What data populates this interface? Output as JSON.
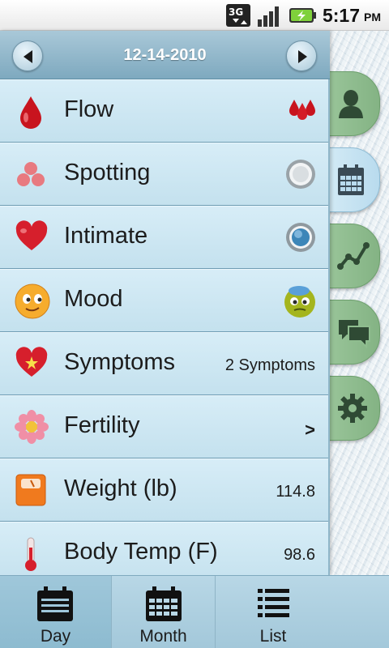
{
  "status_bar": {
    "time": "5:17",
    "ampm": "PM",
    "network_label": "3G"
  },
  "header": {
    "date": "12-14-2010"
  },
  "rows": [
    {
      "label": "Flow",
      "value": "",
      "icon": "blood-drop-icon",
      "right_icon": "heavy-flow-drops-icon"
    },
    {
      "label": "Spotting",
      "value": "",
      "icon": "spotting-dots-icon",
      "right_icon": "radio-off-icon"
    },
    {
      "label": "Intimate",
      "value": "",
      "icon": "heart-icon",
      "right_icon": "radio-on-icon"
    },
    {
      "label": "Mood",
      "value": "",
      "icon": "mood-face-icon",
      "right_icon": "sick-face-icon"
    },
    {
      "label": "Symptoms",
      "value": "2 Symptoms",
      "icon": "heart-sparkle-icon"
    },
    {
      "label": "Fertility",
      "value": ">",
      "icon": "flower-icon"
    },
    {
      "label": "Weight (lb)",
      "value": "114.8",
      "icon": "scale-icon"
    },
    {
      "label": "Body Temp (F)",
      "value": "98.6",
      "icon": "thermometer-icon"
    }
  ],
  "side_tabs": [
    {
      "name": "profile",
      "icon": "person-icon",
      "active": false
    },
    {
      "name": "calendar",
      "icon": "calendar-icon",
      "active": true
    },
    {
      "name": "charts",
      "icon": "chart-line-icon",
      "active": false
    },
    {
      "name": "messages",
      "icon": "chat-bubbles-icon",
      "active": false
    },
    {
      "name": "settings",
      "icon": "gear-icon",
      "active": false
    }
  ],
  "bottom_bar": {
    "day": "Day",
    "month": "Month",
    "list": "List",
    "selected": "Day"
  },
  "colors": {
    "panel": "#cde6f2",
    "header": "#8fb4c8",
    "tab_green": "#8fbd8f",
    "tab_active": "#c9e5f2"
  }
}
